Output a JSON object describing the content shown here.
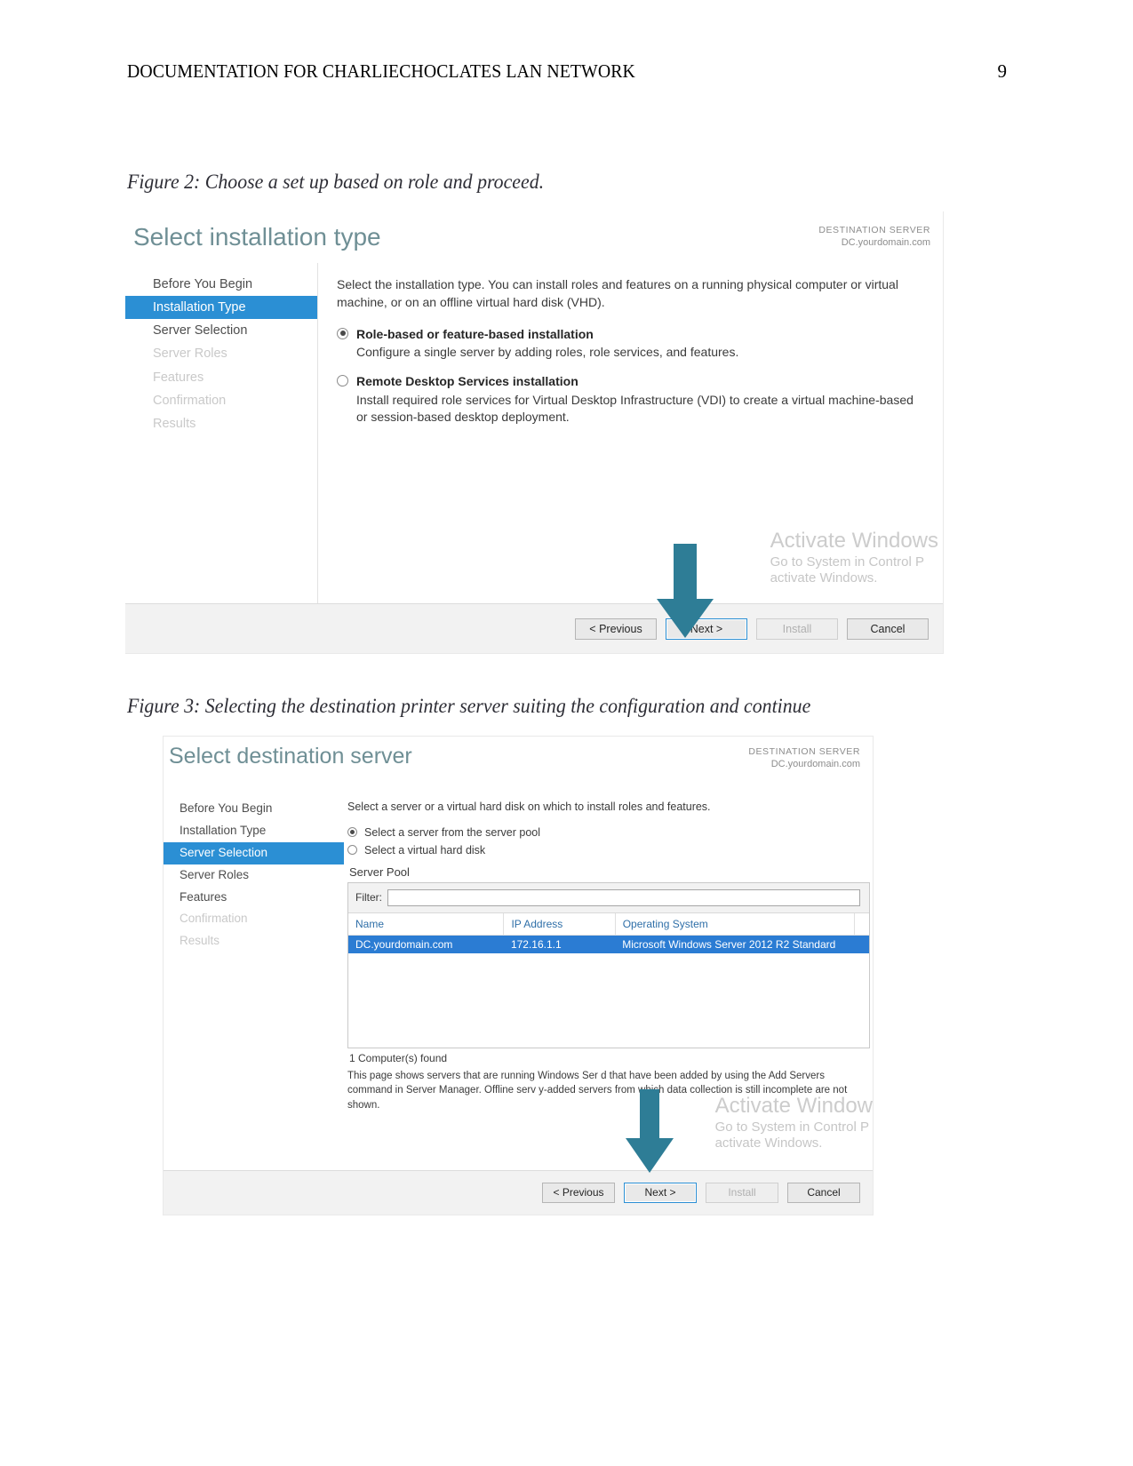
{
  "document": {
    "header_title": "DOCUMENTATION FOR CHARLIECHOCLATES LAN NETWORK",
    "page_number": "9",
    "caption_figure_2": "Figure 2: Choose a set up based on role and proceed.",
    "caption_figure_3": "Figure 3: Selecting the destination printer server suiting the configuration and continue"
  },
  "colors": {
    "accent_blue": "#2b8fd4",
    "selection_blue": "#2b7cd3",
    "wizard_title": "#6f8f95",
    "arrow_teal": "#2e7d96",
    "watermark_gray": "#c9c9c9"
  },
  "figure2": {
    "title": "Select installation type",
    "destination_label": "DESTINATION SERVER",
    "destination_server": "DC.yourdomain.com",
    "nav_items": [
      {
        "label": "Before You Begin",
        "state": "normal"
      },
      {
        "label": "Installation Type",
        "state": "selected"
      },
      {
        "label": "Server Selection",
        "state": "normal"
      },
      {
        "label": "Server Roles",
        "state": "dim"
      },
      {
        "label": "Features",
        "state": "dim"
      },
      {
        "label": "Confirmation",
        "state": "dim"
      },
      {
        "label": "Results",
        "state": "dim"
      }
    ],
    "intro": "Select the installation type. You can install roles and features on a running physical computer or virtual machine, or on an offline virtual hard disk (VHD).",
    "options": [
      {
        "label": "Role-based or feature-based installation",
        "description": "Configure a single server by adding roles, role services, and features.",
        "checked": true
      },
      {
        "label": "Remote Desktop Services installation",
        "description": "Install required role services for Virtual Desktop Infrastructure (VDI) to create a virtual machine-based or session-based desktop deployment.",
        "checked": false
      }
    ],
    "buttons": {
      "previous": "< Previous",
      "next": "Next >",
      "install": "Install",
      "cancel": "Cancel"
    },
    "watermark": {
      "title": "Activate Windows",
      "line1": "Go to System in Control P",
      "line2": "activate Windows."
    }
  },
  "figure3": {
    "title": "Select destination server",
    "destination_label": "DESTINATION SERVER",
    "destination_server": "DC.yourdomain.com",
    "nav_items": [
      {
        "label": "Before You Begin",
        "state": "normal"
      },
      {
        "label": "Installation Type",
        "state": "normal"
      },
      {
        "label": "Server Selection",
        "state": "selected"
      },
      {
        "label": "Server Roles",
        "state": "normal"
      },
      {
        "label": "Features",
        "state": "normal"
      },
      {
        "label": "Confirmation",
        "state": "dim"
      },
      {
        "label": "Results",
        "state": "dim"
      }
    ],
    "intro": "Select a server or a virtual hard disk on which to install roles and features.",
    "options": [
      {
        "label": "Select a server from the server pool",
        "checked": true
      },
      {
        "label": "Select a virtual hard disk",
        "checked": false
      }
    ],
    "pool_label": "Server Pool",
    "filter_label": "Filter:",
    "filter_value": "",
    "filter_placeholder": "",
    "table": {
      "columns": [
        "Name",
        "IP Address",
        "Operating System"
      ],
      "rows": [
        {
          "name": "DC.yourdomain.com",
          "ip": "172.16.1.1",
          "os": "Microsoft Windows Server 2012 R2 Standard",
          "selected": true
        }
      ]
    },
    "computer_count": "1 Computer(s) found",
    "note": "This page shows servers that are running Windows Ser                        d that have been added by using the Add Servers command in Server Manager. Offline serv                        y-added servers from which data collection is still incomplete are not shown.",
    "buttons": {
      "previous": "< Previous",
      "next": "Next >",
      "install": "Install",
      "cancel": "Cancel"
    },
    "watermark": {
      "title": "Activate Windows",
      "line1": "Go to System in Control P",
      "line2": "activate Windows."
    }
  }
}
